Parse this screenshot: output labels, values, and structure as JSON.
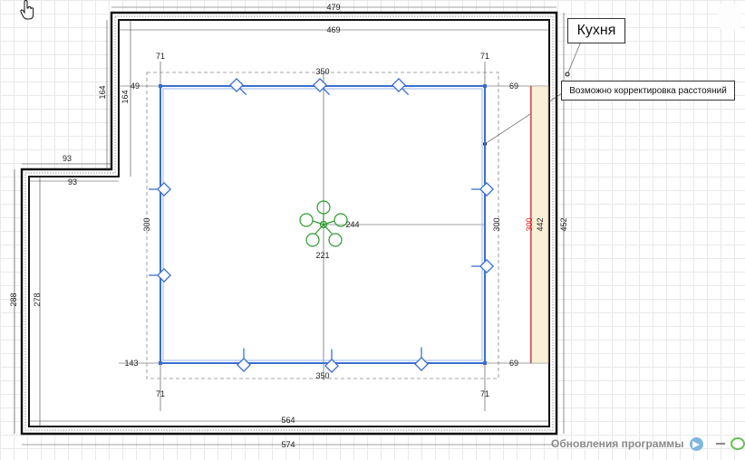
{
  "room_label": "Кухня",
  "note": "Возможно корректировка расстояний",
  "footer": {
    "updates_label": "Обновления программы"
  },
  "icons": {
    "cursor": "hand-pointer-icon",
    "telegram": "telegram-icon",
    "chandelier": "chandelier-icon",
    "spotlight": "spotlight-icon"
  },
  "colors": {
    "ceiling_outline": "#3a6fd1",
    "chandelier": "#2e9b2e",
    "accent_dim": "#d11111",
    "panel_fill": "#faf0d7"
  },
  "dims": {
    "top_outer": "479",
    "top_inner": "469",
    "frame_top": "350",
    "frame_bottom": "350",
    "left_171": "71",
    "right_171": "71",
    "left_b71": "71",
    "right_b71": "71",
    "left_49": "49",
    "right_69": "69",
    "right_b69": "69",
    "left_143": "143",
    "wall_164a": "164",
    "wall_164b": "164",
    "step_93a": "93",
    "step_93b": "93",
    "left_288": "288",
    "left_278": "278",
    "frame_left_300": "300",
    "frame_right_300": "300",
    "red_300": "300",
    "right_442": "442",
    "right_452": "452",
    "center_244": "244",
    "center_221": "221",
    "bottom_inner": "564",
    "bottom_outer": "574"
  }
}
